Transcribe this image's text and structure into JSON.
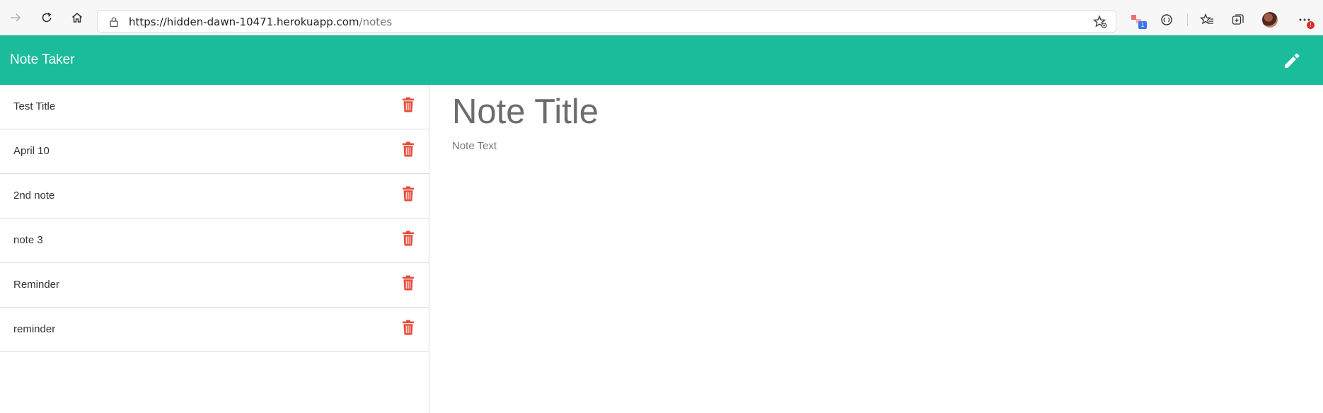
{
  "browser": {
    "url_base": "https://hidden-dawn-10471.herokuapp.com",
    "url_path": "/notes",
    "extension_badge": "1",
    "menu_badge": "!"
  },
  "app": {
    "brand": "Note Taker",
    "accent_color": "#1abc9c",
    "delete_color": "#e74c3c"
  },
  "notes": [
    {
      "title": "Test Title"
    },
    {
      "title": "April 10"
    },
    {
      "title": "2nd note"
    },
    {
      "title": "note 3"
    },
    {
      "title": "Reminder"
    },
    {
      "title": "reminder"
    }
  ],
  "editor": {
    "title_placeholder": "Note Title",
    "text_placeholder": "Note Text"
  }
}
